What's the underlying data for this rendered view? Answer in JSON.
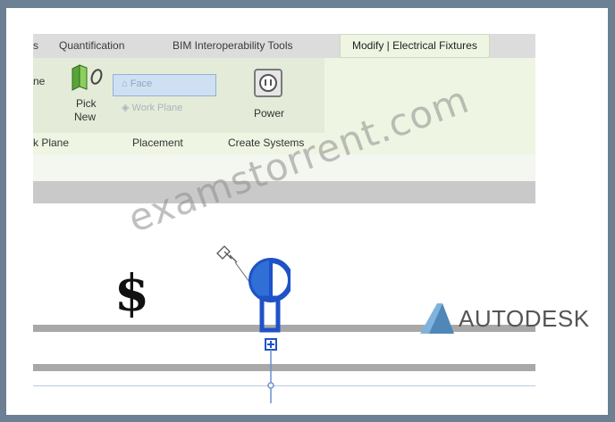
{
  "ribbon_tabs": [
    {
      "label": "s"
    },
    {
      "label": "Quantification"
    },
    {
      "label": "BIM Interoperability Tools"
    },
    {
      "label": "Modify | Electrical Fixtures"
    }
  ],
  "work_plane_panel": {
    "button_label_1": "Pick",
    "button_label_2": "New",
    "cut_label": "ne",
    "panel_title": "k Plane"
  },
  "placement_panel": {
    "face_label": "Face",
    "work_plane_label": "Work Plane",
    "panel_title": "Placement"
  },
  "create_systems_panel": {
    "power_label": "Power",
    "panel_title": "Create Systems"
  },
  "canvas": {
    "dollar_symbol": "$"
  },
  "watermark": "examstorrent.com",
  "logo": "AUTODESK",
  "colors": {
    "fixture_blue": "#1f52c7",
    "ribbon_green": "#eef5e2"
  }
}
